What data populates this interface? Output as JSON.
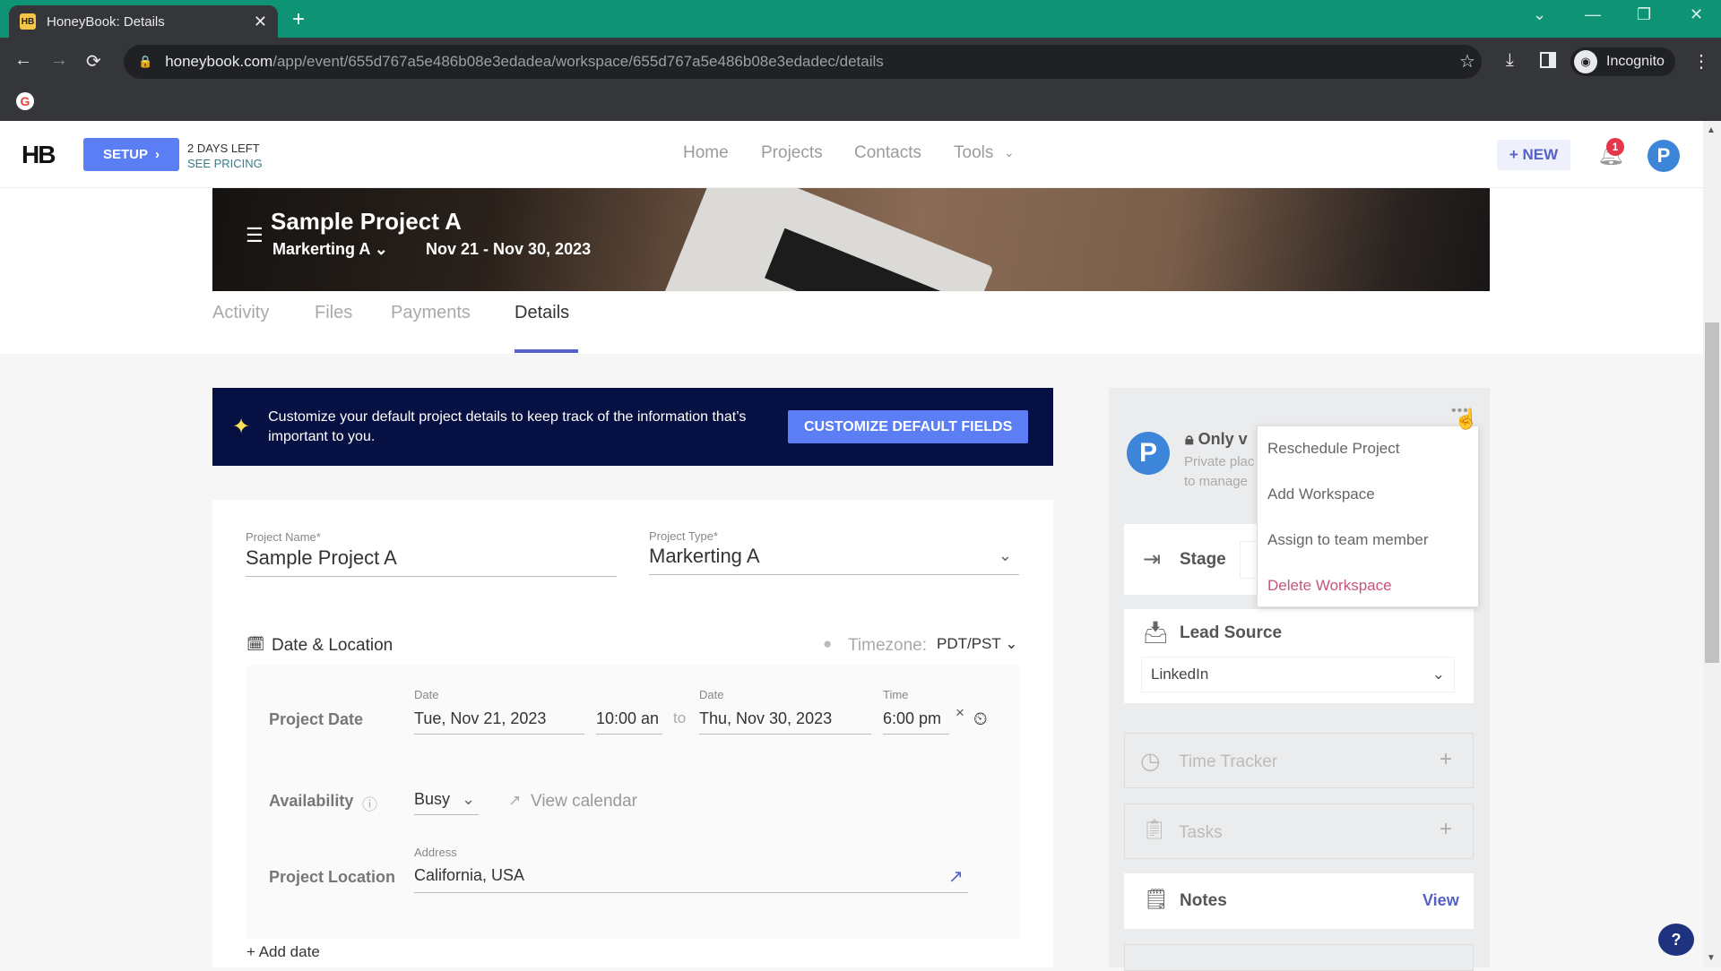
{
  "browser": {
    "tab_title": "HoneyBook: Details",
    "tab_favicon": "HB",
    "url_host": "honeybook.com",
    "url_path": "/app/event/655d767a5e486b08e3edadea/workspace/655d767a5e486b08e3edadec/details",
    "profile_label": "Incognito",
    "icons": {
      "back": "←",
      "forward": "→",
      "reload": "⟳",
      "star": "☆",
      "download": "⤓",
      "menu": "⋮",
      "new_tab": "+",
      "close": "✕",
      "minimize": "—",
      "restore": "❐",
      "tab_search": "⌄",
      "lock": "🔒",
      "google": "G"
    }
  },
  "header": {
    "logo": "HB",
    "setup_label": "SETUP",
    "setup_chevron": "›",
    "trial_days": "2 DAYS LEFT",
    "see_pricing": "SEE PRICING",
    "nav": [
      "Home",
      "Projects",
      "Contacts",
      "Tools"
    ],
    "tools_chevron": "⌄",
    "new_label": "+ NEW",
    "notification_count": "1",
    "avatar_initial": "P"
  },
  "project": {
    "title": "Sample Project A",
    "type": "Markerting A",
    "dates": "Nov 21 - Nov 30, 2023",
    "tabs": [
      "Activity",
      "Files",
      "Payments",
      "Details"
    ],
    "active_tab": "Details"
  },
  "promo": {
    "text": "Customize your default project details to keep track of the information that’s important to you.",
    "button": "CUSTOMIZE DEFAULT FIELDS"
  },
  "form": {
    "project_name_label": "Project Name*",
    "project_name_value": "Sample Project A",
    "project_type_label": "Project Type*",
    "project_type_value": "Markerting A",
    "section_title": "Date & Location",
    "timezone_label": "Timezone:",
    "timezone_value": "PDT/PST",
    "project_date_label": "Project Date",
    "start_date_label": "Date",
    "start_date": "Tue, Nov 21, 2023",
    "start_time": "10:00 an",
    "to": "to",
    "end_date_label": "Date",
    "end_date": "Thu, Nov 30, 2023",
    "end_time_label": "Time",
    "end_time": "6:00 pm",
    "clear": "×",
    "availability_label": "Availability",
    "availability_value": "Busy",
    "view_calendar": "View calendar",
    "location_label": "Project Location",
    "address_label": "Address",
    "address_value": "California, USA",
    "add_date": "+ Add date"
  },
  "right_panel": {
    "avatar_initial": "P",
    "visibility_title": "Only v",
    "visibility_desc_1": "Private plac",
    "visibility_desc_2": "to manage",
    "stage_label": "Stage",
    "lead_source_label": "Lead Source",
    "lead_source_value": "LinkedIn",
    "time_tracker_label": "Time Tracker",
    "tasks_label": "Tasks",
    "notes_label": "Notes",
    "notes_action": "View",
    "plus": "+"
  },
  "menu": {
    "items": [
      "Reschedule Project",
      "Add Workspace",
      "Assign to team member",
      "Delete Workspace"
    ]
  },
  "help_label": "?"
}
